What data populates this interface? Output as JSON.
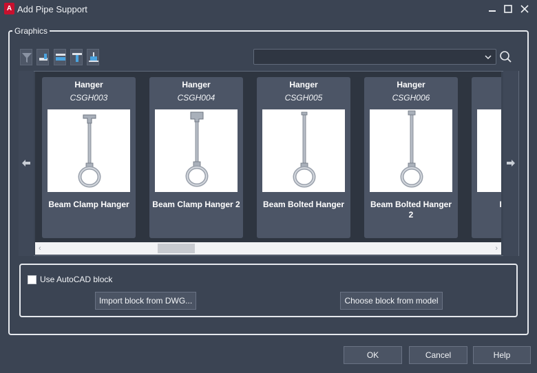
{
  "window": {
    "title": "Add Pipe Support",
    "app_icon_letter": "A"
  },
  "graphics": {
    "group_label": "Graphics",
    "toolbar_icons": [
      "filter-icon",
      "pipe-elbow-icon",
      "pipe-horizontal-icon",
      "pipe-top-icon",
      "pipe-vertical-icon"
    ],
    "search": {
      "value": "",
      "search_icon": "magnifier-icon"
    },
    "cards": [
      {
        "category": "Hanger",
        "code": "CSGH003",
        "name": "Beam Clamp Hanger",
        "image": "clamp-hanger"
      },
      {
        "category": "Hanger",
        "code": "CSGH004",
        "name": "Beam Clamp Hanger 2",
        "image": "clamp-hanger"
      },
      {
        "category": "Hanger",
        "code": "CSGH005",
        "name": "Beam Bolted Hanger",
        "image": "bolted-hanger"
      },
      {
        "category": "Hanger",
        "code": "CSGH006",
        "name": "Beam Bolted Hanger 2",
        "image": "bolted-hanger"
      },
      {
        "category": "",
        "code": "",
        "name": "Beam w...",
        "image": ""
      }
    ]
  },
  "block": {
    "use_autocad_label": "Use AutoCAD block",
    "use_autocad_checked": false,
    "import_button": "Import block from DWG...",
    "choose_button": "Choose block from model"
  },
  "footer": {
    "ok": "OK",
    "cancel": "Cancel",
    "help": "Help"
  },
  "colors": {
    "background": "#3b4453",
    "card": "#4c5566",
    "gallery": "#2e3540",
    "app_icon": "#c8102e"
  }
}
